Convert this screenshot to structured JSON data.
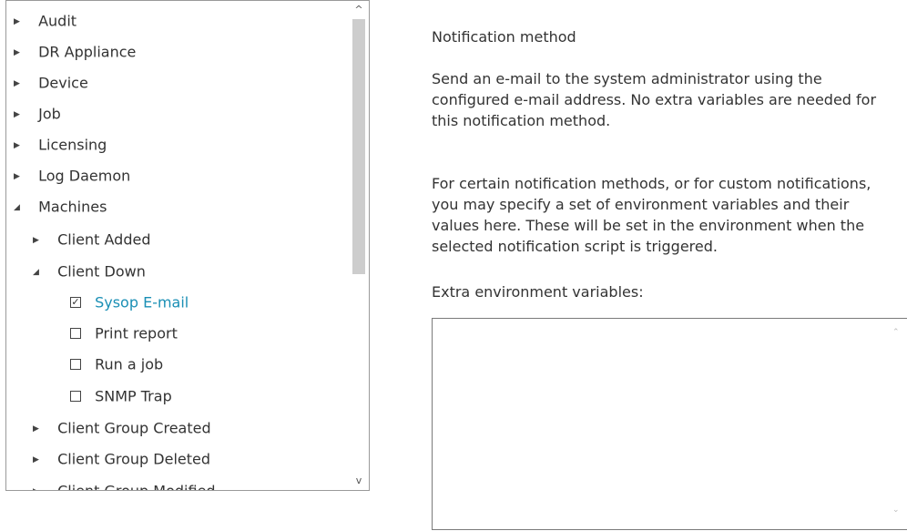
{
  "tree": {
    "items": [
      {
        "label": "Audit",
        "arrow": "▶",
        "type": "node"
      },
      {
        "label": "DR Appliance",
        "arrow": "▶",
        "type": "node"
      },
      {
        "label": "Device",
        "arrow": "▶",
        "type": "node"
      },
      {
        "label": "Job",
        "arrow": "▶",
        "type": "node"
      },
      {
        "label": "Licensing",
        "arrow": "▶",
        "type": "node"
      },
      {
        "label": "Log Daemon",
        "arrow": "▶",
        "type": "node"
      },
      {
        "label": "Machines",
        "arrow": "◢",
        "type": "node-open"
      },
      {
        "label": "Client Added",
        "arrow": "▶",
        "type": "node"
      },
      {
        "label": "Client Down",
        "arrow": "◢",
        "type": "node-open"
      },
      {
        "label": "Sysop E-mail",
        "checked": true,
        "type": "check"
      },
      {
        "label": "Print report",
        "checked": false,
        "type": "check"
      },
      {
        "label": "Run a job",
        "checked": false,
        "type": "check"
      },
      {
        "label": "SNMP Trap",
        "checked": false,
        "type": "check"
      },
      {
        "label": "Client Group Created",
        "arrow": "▶",
        "type": "node"
      },
      {
        "label": "Client Group Deleted",
        "arrow": "▶",
        "type": "node"
      },
      {
        "label": "Client Group Modified",
        "arrow": "▶",
        "type": "node"
      }
    ]
  },
  "scrollbar": {
    "up": "^",
    "down": "v"
  },
  "details": {
    "heading": "Notification method",
    "desc_lines": [
      "Send an e-mail to the system administrator using the",
      "configured e-mail address. No extra variables are needed for",
      "this notification method."
    ],
    "env_lines": [
      "For certain notification methods, or for custom notifications,",
      "you may specify a set of environment variables and their",
      "values here. These will be set in the environment when the",
      "selected notification script is triggered."
    ],
    "extra_label": "Extra environment variables:",
    "extra_value": ""
  },
  "colors": {
    "selected": "#1a8fb5",
    "border": "#9a9a9a",
    "thumb": "#cdcdcd"
  }
}
